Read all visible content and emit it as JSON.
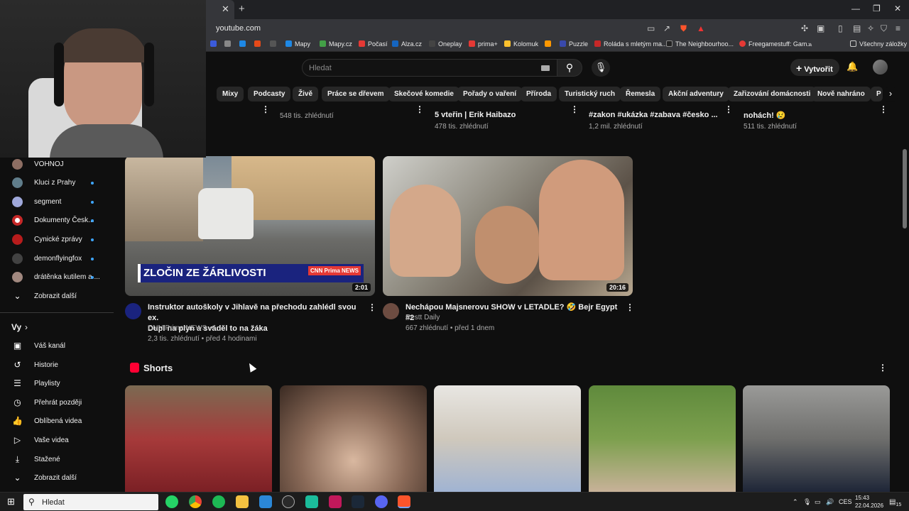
{
  "browser": {
    "url": "youtube.com",
    "bookmarks": [
      "Mapy",
      "Mapy.cz",
      "Počasí",
      "Alza.cz",
      "Oneplay",
      "prima+",
      "Kolomuk",
      "Puzzle",
      "Roláda s mletým ma...",
      "The Neighbourhoo...",
      "Freegamestuff: Gam..."
    ],
    "all_bookmarks": "Všechny záložky"
  },
  "header": {
    "search_placeholder": "Hledat",
    "create_label": "Vytvořit"
  },
  "chips": [
    "Mixy",
    "Podcasty",
    "Živě",
    "Práce se dřevem",
    "Skečové komedie",
    "Pořady o vaření",
    "Příroda",
    "Turistický ruch",
    "Řemesla",
    "Akční adventury",
    "Zařizování domácnosti",
    "Nově nahráno",
    "P"
  ],
  "top_row": [
    {
      "title": "",
      "views": "548 tis. zhlédnutí"
    },
    {
      "title": "5 vteřin | Erik Haibazo",
      "views": "478 tis. zhlédnutí"
    },
    {
      "title": "#zakon #ukázka #zabava #česko ...",
      "views": "1,2 mil. zhlédnutí"
    },
    {
      "title": "nohách! 😢",
      "views": "511 tis. zhlédnutí"
    }
  ],
  "sidebar": {
    "subscriptions": [
      {
        "label": "VOHNOJ",
        "dot": false
      },
      {
        "label": "Kluci z Prahy",
        "dot": true
      },
      {
        "label": "segment",
        "dot": true
      },
      {
        "label": "Dokumenty Česk...",
        "dot": true
      },
      {
        "label": "Cynické zprávy",
        "dot": true
      },
      {
        "label": "demonflyingfox",
        "dot": true
      },
      {
        "label": "drátěnka kutilem a ...",
        "dot": true
      }
    ],
    "show_more": "Zobrazit další",
    "you_heading": "Vy",
    "you_items": [
      "Váš kanál",
      "Historie",
      "Playlisty",
      "Přehrát později",
      "Oblíbená videa",
      "Vaše videa",
      "Stažené",
      "Zobrazit další"
    ]
  },
  "videos": [
    {
      "title_line1": "Instruktor autoškoly v Jihlavě na přechodu zahlédl svou ex.",
      "title_line2": "Dupl na plyn a sváděl to na žáka",
      "channel": "CNN Prima NEWS",
      "meta": "2,3 tis. zhlédnutí • před 4 hodinami",
      "duration": "2:01",
      "banner": "ZLOČIN ZE ŽÁRLIVOSTI",
      "brand": "CNN Prima NEWS"
    },
    {
      "title_line1": "Nechápou Majsnerovu SHOW v LETADLE? 🤣 Bejr Egypt #2",
      "title_line2": "",
      "channel": "Restt Daily",
      "meta": "667 zhlédnutí • před 1 dnem",
      "duration": "20:16"
    }
  ],
  "shorts": {
    "heading": "Shorts"
  },
  "taskbar": {
    "search_label": "Hledat",
    "lang": "CES",
    "time": "15:43",
    "date": "22.04.2026",
    "notifications": "15"
  }
}
